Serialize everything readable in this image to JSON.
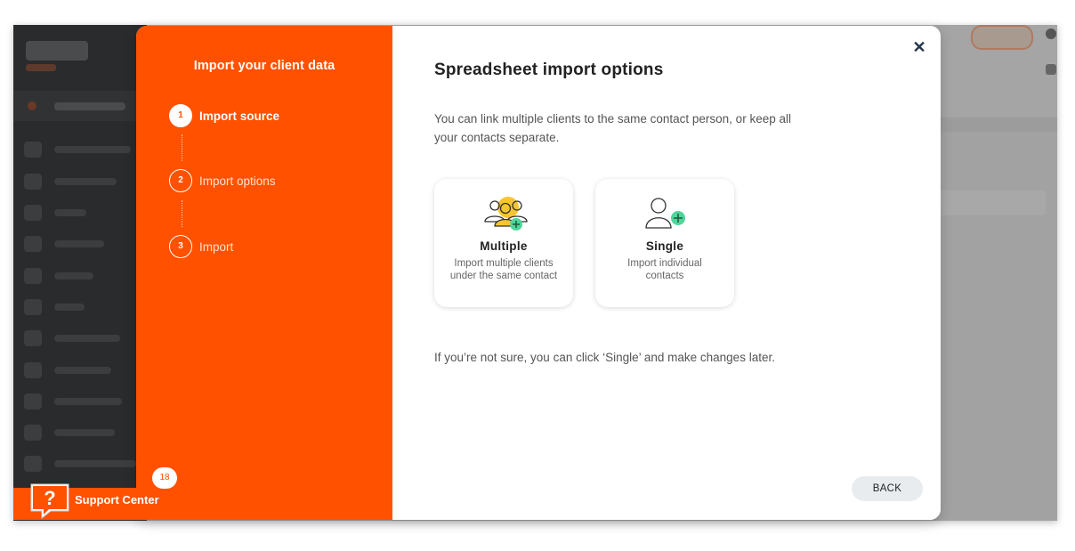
{
  "modal": {
    "sidebar_title": "Import your client data",
    "steps": [
      {
        "number": "1",
        "label": "Import source",
        "active": true
      },
      {
        "number": "2",
        "label": "Import options",
        "active": false
      },
      {
        "number": "3",
        "label": "Import",
        "active": false
      }
    ],
    "title": "Spreadsheet import options",
    "description": "You can link multiple clients to the same contact person, or keep all your contacts separate.",
    "options": [
      {
        "name": "Multiple",
        "description": "Import multiple clients under the same contact",
        "icon": "group-add-icon"
      },
      {
        "name": "Single",
        "description": "Import individual contacts",
        "icon": "person-add-icon"
      }
    ],
    "note": "If you’re not sure, you can click ‘Single’ and make changes later.",
    "back_label": "BACK",
    "close_icon": "close-icon",
    "close_glyph": "✕"
  },
  "support": {
    "label": "Support Center",
    "badge": "18",
    "icon": "help-chat-icon"
  },
  "colors": {
    "accent": "#ff5100",
    "add_green": "#4fd59a",
    "group_yellow": "#f7c531",
    "close_navy": "#26364a"
  }
}
